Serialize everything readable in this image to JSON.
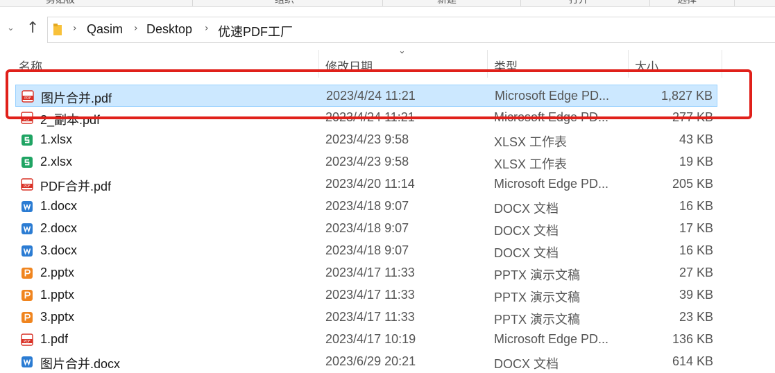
{
  "ribbon": {
    "groups": [
      "剪贴板",
      "组织",
      "新建",
      "打开",
      "选择"
    ]
  },
  "nav": {
    "breadcrumb": [
      "Qasim",
      "Desktop",
      "优速PDF工厂"
    ]
  },
  "columns": {
    "name": "名称",
    "date": "修改日期",
    "type": "类型",
    "size": "大小"
  },
  "files": [
    {
      "name": "图片合并.pdf",
      "date": "2023/4/24 11:21",
      "type": "Microsoft Edge PD...",
      "size": "1,827 KB",
      "icon": "pdf-icon",
      "selected": true
    },
    {
      "name": "2_副本.pdf",
      "date": "2023/4/24 11:21",
      "type": "Microsoft Edge PD...",
      "size": "277 KB",
      "icon": "pdf-icon"
    },
    {
      "name": "1.xlsx",
      "date": "2023/4/23 9:58",
      "type": "XLSX 工作表",
      "size": "43 KB",
      "icon": "spreadsheet-icon"
    },
    {
      "name": "2.xlsx",
      "date": "2023/4/23 9:58",
      "type": "XLSX 工作表",
      "size": "19 KB",
      "icon": "spreadsheet-icon"
    },
    {
      "name": "PDF合并.pdf",
      "date": "2023/4/20 11:14",
      "type": "Microsoft Edge PD...",
      "size": "205 KB",
      "icon": "pdf-icon"
    },
    {
      "name": "1.docx",
      "date": "2023/4/18 9:07",
      "type": "DOCX 文档",
      "size": "16 KB",
      "icon": "word-icon"
    },
    {
      "name": "2.docx",
      "date": "2023/4/18 9:07",
      "type": "DOCX 文档",
      "size": "17 KB",
      "icon": "word-icon"
    },
    {
      "name": "3.docx",
      "date": "2023/4/18 9:07",
      "type": "DOCX 文档",
      "size": "16 KB",
      "icon": "word-icon"
    },
    {
      "name": "2.pptx",
      "date": "2023/4/17 11:33",
      "type": "PPTX 演示文稿",
      "size": "27 KB",
      "icon": "presentation-icon"
    },
    {
      "name": "1.pptx",
      "date": "2023/4/17 11:33",
      "type": "PPTX 演示文稿",
      "size": "39 KB",
      "icon": "presentation-icon"
    },
    {
      "name": "3.pptx",
      "date": "2023/4/17 11:33",
      "type": "PPTX 演示文稿",
      "size": "23 KB",
      "icon": "presentation-icon"
    },
    {
      "name": "1.pdf",
      "date": "2023/4/17 10:19",
      "type": "Microsoft Edge PD...",
      "size": "136 KB",
      "icon": "pdf-icon"
    },
    {
      "name": "图片合并.docx",
      "date": "2023/6/29 20:21",
      "type": "DOCX 文档",
      "size": "614 KB",
      "icon": "word-icon"
    }
  ],
  "colors": {
    "selected_bg": "#cce8ff",
    "highlight_border": "#e0201a",
    "pdf": "#d93025",
    "spreadsheet": "#1fa463",
    "word": "#2b7cd3",
    "presentation": "#f0851f"
  }
}
